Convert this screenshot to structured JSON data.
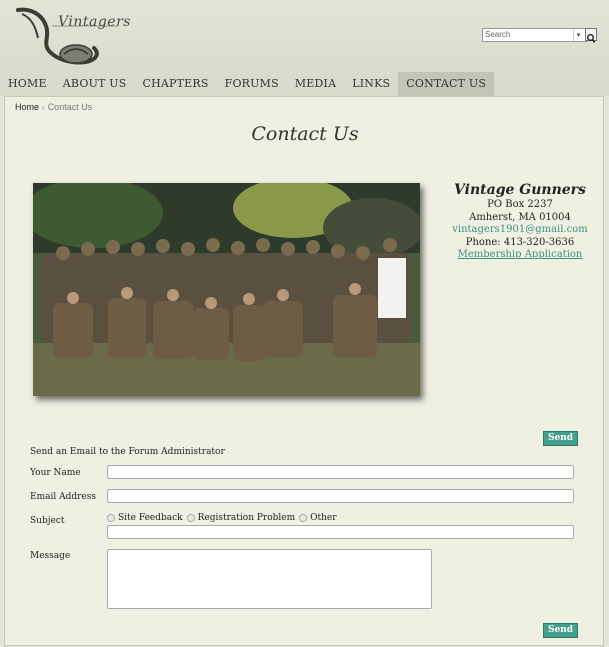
{
  "site": {
    "logo_text": "Vintagers"
  },
  "search": {
    "placeholder": "Search"
  },
  "nav": [
    "HOME",
    "ABOUT US",
    "CHAPTERS",
    "FORUMS",
    "MEDIA",
    "LINKS",
    "CONTACT US"
  ],
  "breadcrumb": {
    "home": "Home",
    "separator": "›",
    "current": "Contact Us"
  },
  "page": {
    "title": "Contact Us"
  },
  "contact": {
    "org": "Vintage Gunners",
    "po": "PO Box 2237",
    "city": "Amherst, MA 01004",
    "email": "vintagers1901@gmail.com",
    "phone": "Phone: 413-320-3636",
    "membership": "Membership Application"
  },
  "form": {
    "heading": "Send an Email to the Forum Administrator",
    "name_label": "Your Name",
    "email_label": "Email Address",
    "subject_label": "Subject",
    "subject_options": [
      "Site Feedback",
      "Registration Problem",
      "Other"
    ],
    "message_label": "Message",
    "send_label": "Send"
  },
  "colors": {
    "accent": "#44a08e",
    "link": "#3b8f80",
    "active_tab": "#c4c4b6"
  }
}
